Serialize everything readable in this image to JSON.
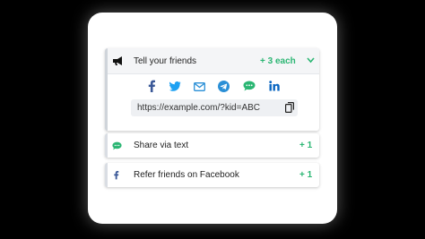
{
  "header": {
    "title": "Tell your friends",
    "count": "+ 3 each"
  },
  "share_icons": [
    "facebook-icon",
    "twitter-icon",
    "email-icon",
    "telegram-icon",
    "message-icon",
    "linkedin-icon"
  ],
  "referral_url": "https://example.com/?kid=ABC",
  "options": [
    {
      "label": "Share via text",
      "count": "+ 1",
      "icon": "message-icon"
    },
    {
      "label": "Refer friends on Facebook",
      "count": "+ 1",
      "icon": "facebook-icon"
    }
  ],
  "colors": {
    "accent": "#2bb673",
    "facebook": "#3b5998",
    "twitter": "#1da1f2",
    "email": "#2a8fd6",
    "telegram": "#2a8fd6",
    "message": "#2bb673",
    "linkedin": "#0a66c2"
  }
}
